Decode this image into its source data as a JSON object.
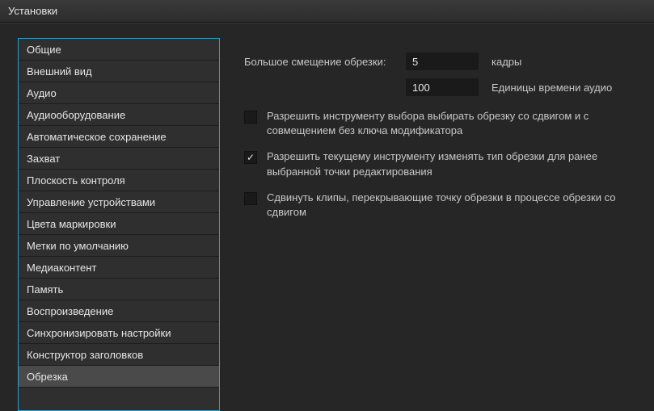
{
  "window": {
    "title": "Установки"
  },
  "sidebar": {
    "items": [
      {
        "label": "Общие"
      },
      {
        "label": "Внешний вид"
      },
      {
        "label": "Аудио"
      },
      {
        "label": "Аудиооборудование"
      },
      {
        "label": "Автоматическое сохранение"
      },
      {
        "label": "Захват"
      },
      {
        "label": "Плоскость контроля"
      },
      {
        "label": "Управление устройствами"
      },
      {
        "label": "Цвета маркировки"
      },
      {
        "label": "Метки по умолчанию"
      },
      {
        "label": "Медиаконтент"
      },
      {
        "label": "Память"
      },
      {
        "label": "Воспроизведение"
      },
      {
        "label": "Синхронизировать настройки"
      },
      {
        "label": "Конструктор заголовков"
      },
      {
        "label": "Обрезка"
      }
    ],
    "selected_index": 15
  },
  "content": {
    "big_trim_offset": {
      "label": "Большое смещение обрезки:",
      "frames_value": "5",
      "frames_unit": "кадры",
      "audio_value": "100",
      "audio_unit": "Единицы времени аудио"
    },
    "checkboxes": [
      {
        "checked": false,
        "label": "Разрешить инструменту выбора выбирать обрезку со сдвигом и с совмещением без ключа модификатора"
      },
      {
        "checked": true,
        "label": "Разрешить текущему инструменту изменять тип обрезки для ранее выбранной точки редактирования"
      },
      {
        "checked": false,
        "label": "Сдвинуть клипы, перекрывающие точку обрезки в процессе обрезки со сдвигом"
      }
    ]
  }
}
